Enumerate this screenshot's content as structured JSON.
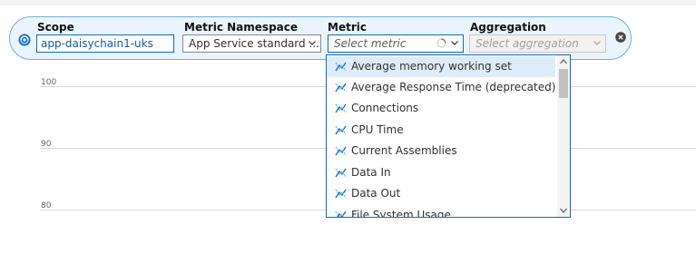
{
  "scope": {
    "label": "Scope",
    "value": "app-daisychain1-uks"
  },
  "namespace": {
    "label": "Metric Namespace",
    "value": "App Service standard ..."
  },
  "metric": {
    "label": "Metric",
    "placeholder": "Select metric"
  },
  "aggregation": {
    "label": "Aggregation",
    "placeholder": "Select aggregation"
  },
  "chart": {
    "y_ticks": [
      "100",
      "90",
      "80"
    ]
  },
  "dropdown": {
    "options": [
      "Average memory working set",
      "Average Response Time (deprecated)",
      "Connections",
      "CPU Time",
      "Current Assemblies",
      "Data In",
      "Data Out",
      "File System Usage"
    ],
    "selected_index": 0
  },
  "colors": {
    "accent": "#0f6cbd",
    "pill_bg": "#ebf4fd",
    "selected_bg": "#deecf9"
  },
  "icons": [
    "scope-icon",
    "chevron-down-icon",
    "loading-spinner-icon",
    "close-icon",
    "metric-icon",
    "scroll-up-icon",
    "scroll-down-icon"
  ]
}
